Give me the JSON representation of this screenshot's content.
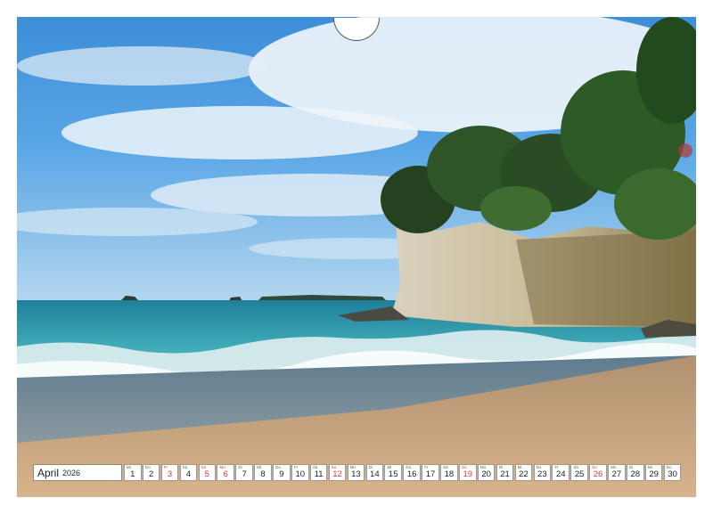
{
  "calendar": {
    "month": "April",
    "year": "2026",
    "weekdays": [
      "Mi",
      "Do",
      "Fr",
      "Sa",
      "So",
      "Mo",
      "Di",
      "Mi",
      "Do",
      "Fr",
      "Sa",
      "So",
      "Mo",
      "Di",
      "Mi",
      "Do",
      "Fr",
      "Sa",
      "So",
      "Mo",
      "Di",
      "Mi",
      "Do",
      "Fr",
      "Sa",
      "So",
      "Mo",
      "Di",
      "Mi",
      "Do"
    ],
    "days": [
      "1",
      "2",
      "3",
      "4",
      "5",
      "6",
      "7",
      "8",
      "9",
      "10",
      "11",
      "12",
      "13",
      "14",
      "15",
      "16",
      "17",
      "18",
      "19",
      "20",
      "21",
      "22",
      "23",
      "24",
      "25",
      "26",
      "27",
      "28",
      "29",
      "30"
    ],
    "red_days": [
      "3",
      "5",
      "6",
      "12",
      "19",
      "26"
    ],
    "highlight_color": "#d53a3a"
  },
  "photo": {
    "subject": "coastal-cliff-beach-scene"
  }
}
